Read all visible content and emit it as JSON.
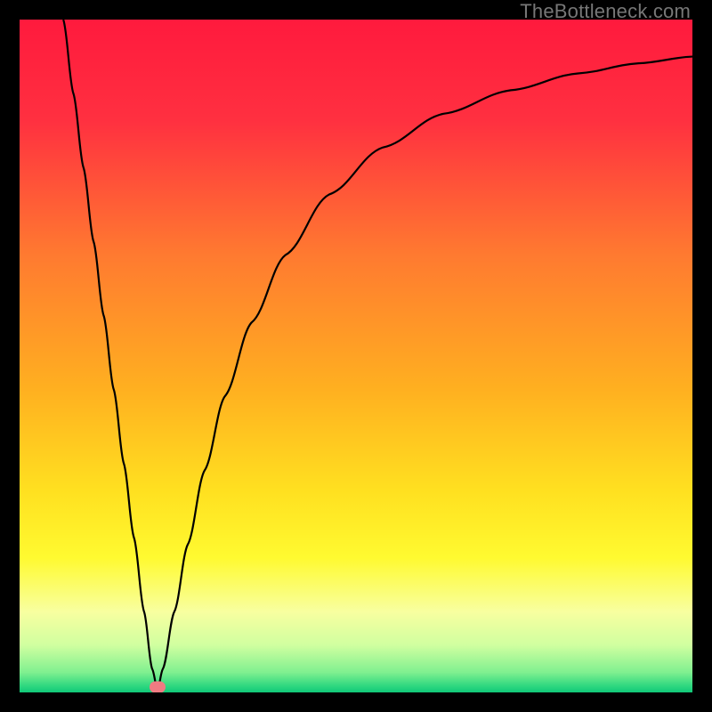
{
  "watermark": "TheBottleneck.com",
  "gradient_stops": [
    {
      "offset": 0,
      "color": "#ff1a3d"
    },
    {
      "offset": 15,
      "color": "#ff3040"
    },
    {
      "offset": 35,
      "color": "#ff7a30"
    },
    {
      "offset": 55,
      "color": "#ffb020"
    },
    {
      "offset": 70,
      "color": "#ffe020"
    },
    {
      "offset": 80,
      "color": "#fffa30"
    },
    {
      "offset": 88,
      "color": "#f8ffa0"
    },
    {
      "offset": 93,
      "color": "#d0ffa0"
    },
    {
      "offset": 97,
      "color": "#80f090"
    },
    {
      "offset": 99,
      "color": "#30d880"
    },
    {
      "offset": 100,
      "color": "#10c878"
    }
  ],
  "marker": {
    "x_frac": 0.205,
    "y_frac": 0.992,
    "color": "#ef7b82"
  },
  "chart_data": {
    "type": "line",
    "title": "",
    "xlabel": "",
    "ylabel": "",
    "xlim": [
      0,
      1
    ],
    "ylim": [
      0,
      1
    ],
    "curve_points": [
      {
        "x": 0.065,
        "y": 1.0
      },
      {
        "x": 0.08,
        "y": 0.89
      },
      {
        "x": 0.095,
        "y": 0.78
      },
      {
        "x": 0.11,
        "y": 0.67
      },
      {
        "x": 0.125,
        "y": 0.56
      },
      {
        "x": 0.14,
        "y": 0.45
      },
      {
        "x": 0.155,
        "y": 0.34
      },
      {
        "x": 0.17,
        "y": 0.23
      },
      {
        "x": 0.185,
        "y": 0.12
      },
      {
        "x": 0.197,
        "y": 0.035
      },
      {
        "x": 0.205,
        "y": 0.004
      },
      {
        "x": 0.213,
        "y": 0.035
      },
      {
        "x": 0.23,
        "y": 0.12
      },
      {
        "x": 0.25,
        "y": 0.22
      },
      {
        "x": 0.275,
        "y": 0.33
      },
      {
        "x": 0.305,
        "y": 0.44
      },
      {
        "x": 0.345,
        "y": 0.55
      },
      {
        "x": 0.395,
        "y": 0.65
      },
      {
        "x": 0.46,
        "y": 0.74
      },
      {
        "x": 0.54,
        "y": 0.81
      },
      {
        "x": 0.63,
        "y": 0.86
      },
      {
        "x": 0.73,
        "y": 0.895
      },
      {
        "x": 0.83,
        "y": 0.92
      },
      {
        "x": 0.92,
        "y": 0.935
      },
      {
        "x": 1.0,
        "y": 0.945
      }
    ],
    "marker_point": {
      "x": 0.205,
      "y": 0.008
    }
  }
}
